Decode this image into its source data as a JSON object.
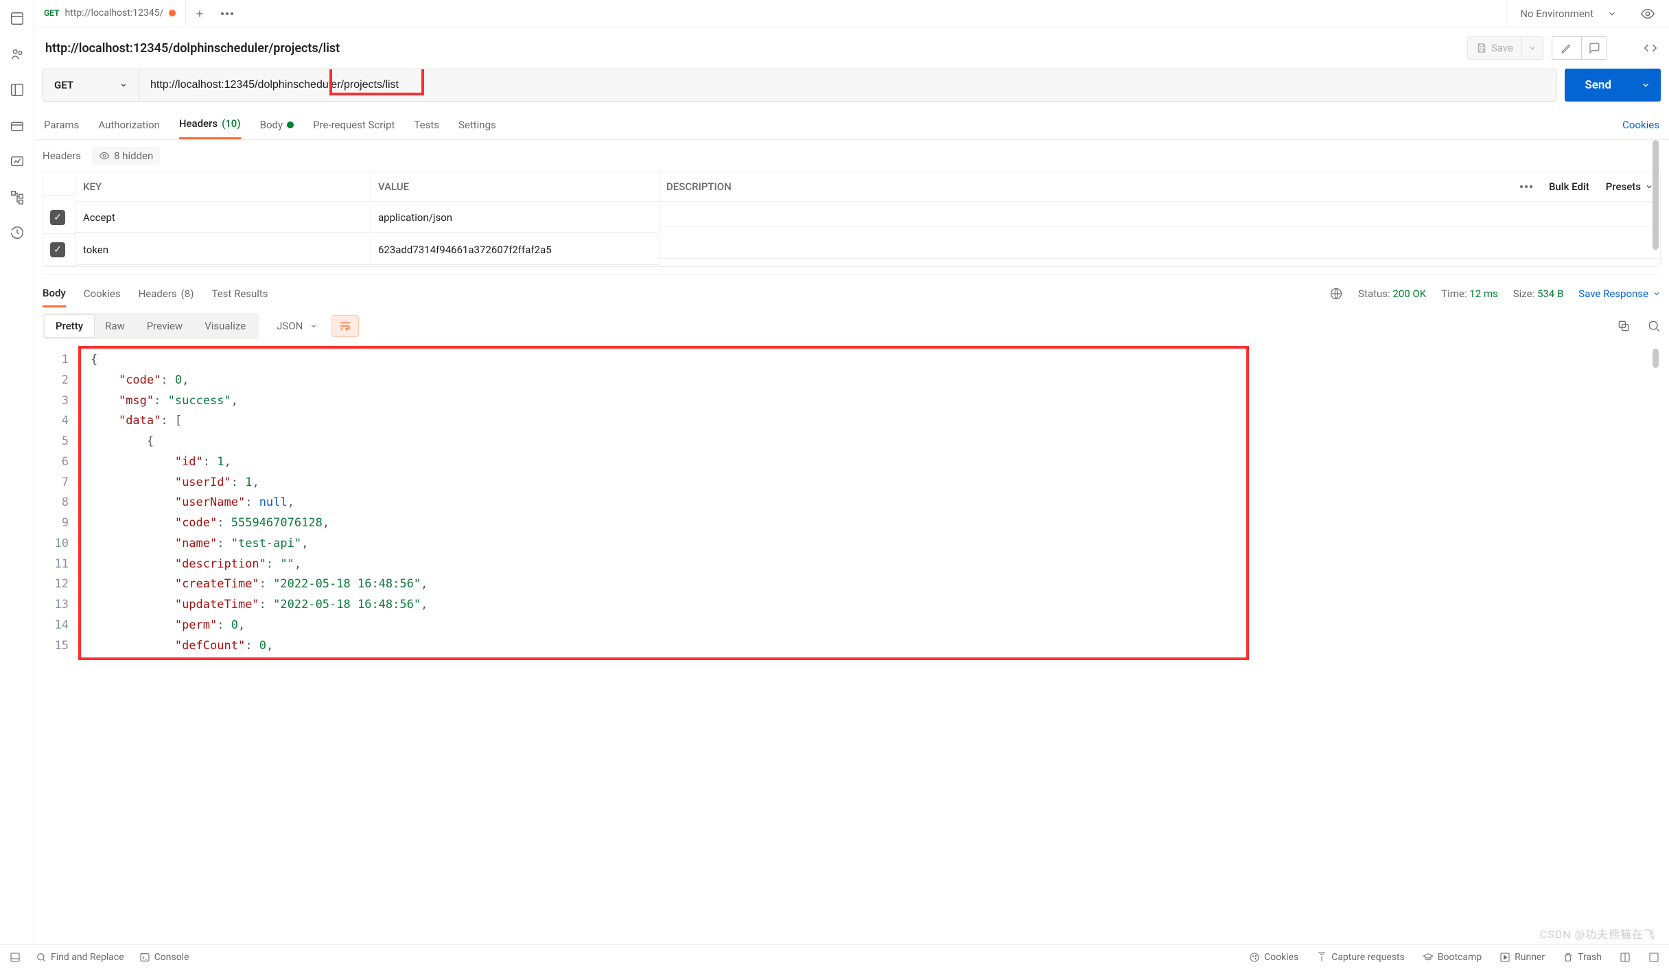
{
  "tabstrip": {
    "tab_method": "GET",
    "tab_title": "http://localhost:12345/",
    "env_label": "No Environment"
  },
  "titlebar": {
    "title": "http://localhost:12345/dolphinscheduler/projects/list",
    "save_label": "Save"
  },
  "url": {
    "method": "GET",
    "value": "http://localhost:12345/dolphinscheduler/projects/list",
    "send_label": "Send"
  },
  "reqtabs": {
    "params": "Params",
    "authorization": "Authorization",
    "headers": "Headers",
    "headers_count": "(10)",
    "body": "Body",
    "prereq": "Pre-request Script",
    "tests": "Tests",
    "settings": "Settings",
    "cookies": "Cookies"
  },
  "headers_panel": {
    "label": "Headers",
    "hidden_label": "8 hidden",
    "cols": {
      "key": "KEY",
      "value": "VALUE",
      "desc": "DESCRIPTION",
      "bulk": "Bulk Edit",
      "presets": "Presets"
    },
    "rows": [
      {
        "checked": true,
        "key": "Accept",
        "value": "application/json",
        "desc": ""
      },
      {
        "checked": true,
        "key": "token",
        "value": "623add7314f94661a372607f2ffaf2a5",
        "desc": ""
      }
    ]
  },
  "resp_tabs": {
    "body": "Body",
    "cookies": "Cookies",
    "headers": "Headers",
    "headers_count": "(8)",
    "tests": "Test Results",
    "status_lbl": "Status:",
    "status": "200 OK",
    "time_lbl": "Time:",
    "time": "12 ms",
    "size_lbl": "Size:",
    "size": "534 B",
    "save": "Save Response"
  },
  "view": {
    "pretty": "Pretty",
    "raw": "Raw",
    "preview": "Preview",
    "visualize": "Visualize",
    "fmt": "JSON"
  },
  "json_lines": [
    "{",
    "    \"code\": 0,",
    "    \"msg\": \"success\",",
    "    \"data\": [",
    "        {",
    "            \"id\": 1,",
    "            \"userId\": 1,",
    "            \"userName\": null,",
    "            \"code\": 5559467076128,",
    "            \"name\": \"test-api\",",
    "            \"description\": \"\",",
    "            \"createTime\": \"2022-05-18 16:48:56\",",
    "            \"updateTime\": \"2022-05-18 16:48:56\",",
    "            \"perm\": 0,",
    "            \"defCount\": 0,"
  ],
  "response_json": {
    "code": 0,
    "msg": "success",
    "data": [
      {
        "id": 1,
        "userId": 1,
        "userName": null,
        "code": 5559467076128,
        "name": "test-api",
        "description": "",
        "createTime": "2022-05-18 16:48:56",
        "updateTime": "2022-05-18 16:48:56",
        "perm": 0,
        "defCount": 0
      }
    ]
  },
  "bottom": {
    "find": "Find and Replace",
    "console": "Console",
    "cookies": "Cookies",
    "capture": "Capture requests",
    "bootcamp": "Bootcamp",
    "runner": "Runner",
    "trash": "Trash"
  }
}
